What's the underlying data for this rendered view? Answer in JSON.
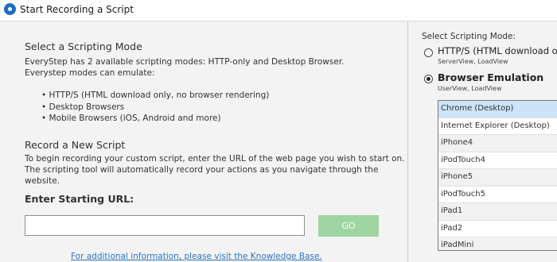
{
  "window": {
    "title": "Start Recording a Script"
  },
  "main": {
    "section1_heading": "Select a Scripting Mode",
    "section1_line1": "EveryStep has 2 available scripting modes: HTTP-only and Desktop Browser.",
    "section1_line2": "Everystep modes can emulate:",
    "bullets": [
      "HTTP/S (HTML download only, no browser rendering)",
      "Desktop Browsers",
      "Mobile Browsers (iOS, Android and more)"
    ],
    "section2_heading": "Record a New Script",
    "section2_line1": "To begin recording your custom script, enter the URL of the web page you wish to start on.",
    "section2_line2": "The scripting tool will automatically record your actions as you navigate through the website.",
    "url_label": "Enter Starting URL:",
    "url_value": "",
    "url_placeholder": "",
    "go_label": "GO",
    "kb_link": "For additional information, please visit the Knowledge Base."
  },
  "sidebar": {
    "mode_label": "Select Scripting Mode:",
    "modes": [
      {
        "title": "HTTP/S (HTML download only)",
        "subtitle": "ServerView, LoadView",
        "checked": false
      },
      {
        "title": "Browser Emulation",
        "subtitle": "UserView, LoadView",
        "checked": true
      }
    ],
    "devices": [
      "Chrome (Desktop)",
      "Internet Explorer (Desktop)",
      "iPhone4",
      "iPodTouch4",
      "iPhone5",
      "iPodTouch5",
      "iPad1",
      "iPad2",
      "iPadMini"
    ],
    "selected_device": "Chrome (Desktop)"
  },
  "colors": {
    "accent": "#1e6fc2",
    "go_button": "#9fd4a3",
    "link": "#2e74c4",
    "selection": "#cde3f7"
  }
}
